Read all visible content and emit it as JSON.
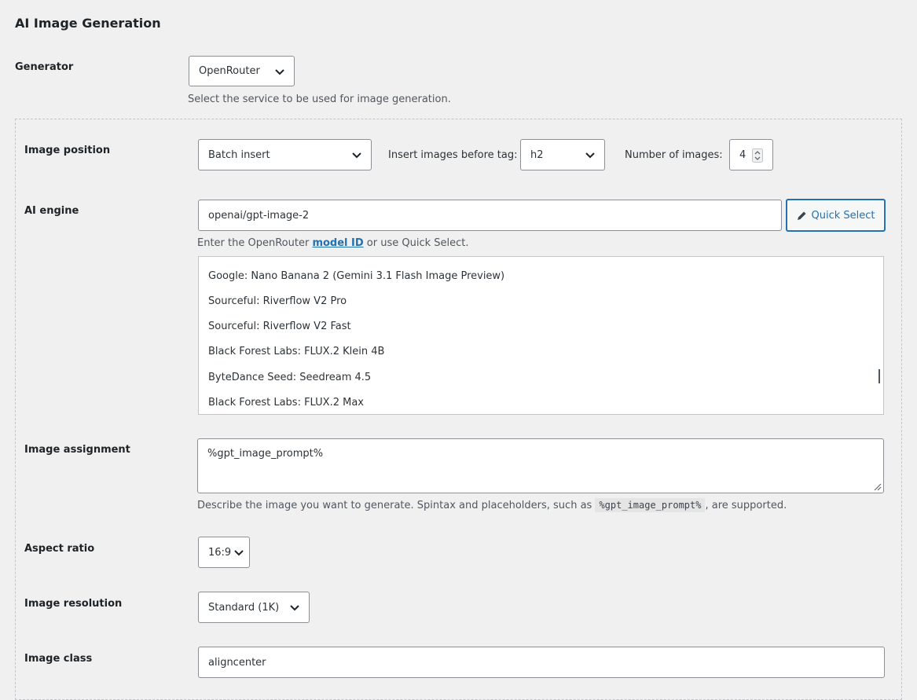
{
  "section_title": "AI Image Generation",
  "generator": {
    "label": "Generator",
    "value": "OpenRouter",
    "description": "Select the service to be used for image generation."
  },
  "image_position": {
    "label": "Image position",
    "value": "Batch insert",
    "tag_label": "Insert images before tag:",
    "tag_value": "h2",
    "count_label": "Number of images:",
    "count_value": "4"
  },
  "ai_engine": {
    "label": "AI engine",
    "value": "openai/gpt-image-2",
    "quick_select_label": "Quick Select",
    "desc_before": "Enter the OpenRouter ",
    "desc_link": "model ID",
    "desc_after": " or use Quick Select.",
    "models": [
      "Google: Nano Banana 2 (Gemini 3.1 Flash Image Preview)",
      "Sourceful: Riverflow V2 Pro",
      "Sourceful: Riverflow V2 Fast",
      "Black Forest Labs: FLUX.2 Klein 4B",
      "ByteDance Seed: Seedream 4.5",
      "Black Forest Labs: FLUX.2 Max"
    ]
  },
  "image_assignment": {
    "label": "Image assignment",
    "value": "%gpt_image_prompt%",
    "desc_before": "Describe the image you want to generate. Spintax and placeholders, such as ",
    "desc_code": "%gpt_image_prompt%",
    "desc_after": ", are supported."
  },
  "aspect_ratio": {
    "label": "Aspect ratio",
    "value": "16:9"
  },
  "image_resolution": {
    "label": "Image resolution",
    "value": "Standard (1K)"
  },
  "image_class": {
    "label": "Image class",
    "value": "aligncenter"
  },
  "colors": {
    "background": "#f0f0f1",
    "accent": "#2271b1",
    "text": "#1d2327",
    "muted": "#50575e"
  },
  "icons": {
    "dropdown": "chevron-down-icon",
    "quick_select": "pencil-icon",
    "number": "spinner-arrows-icon",
    "textarea": "resize-handle-icon"
  }
}
